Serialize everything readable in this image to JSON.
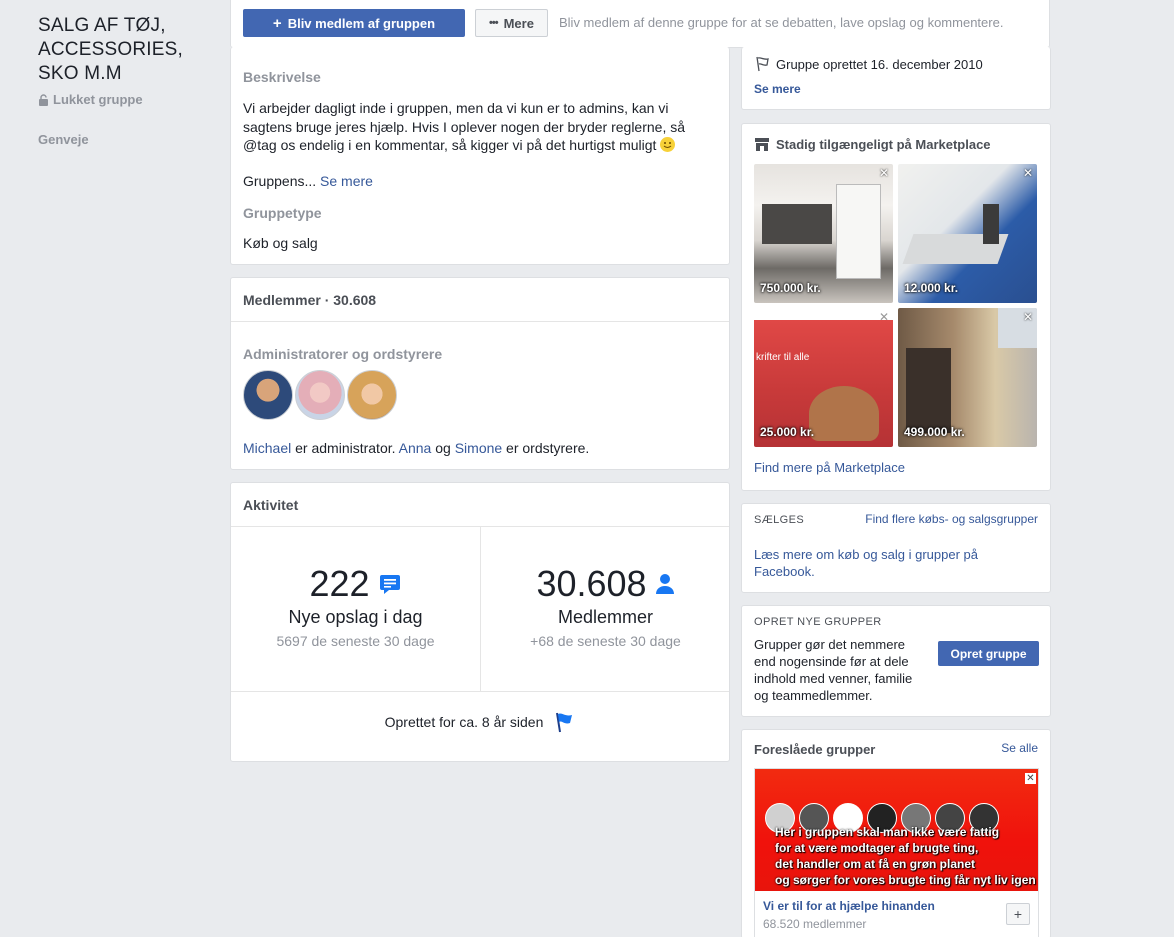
{
  "group": {
    "title": "SALG AF TØJ, ACCESSORIES, SKO M.M",
    "privacy": "Lukket gruppe",
    "shortcuts_label": "Genveje"
  },
  "join_bar": {
    "join_label": "Bliv medlem af gruppen",
    "more_label": "Mere",
    "hint": "Bliv medlem af denne gruppe for at se debatten, lave opslag og kommentere."
  },
  "about": {
    "description_heading": "Beskrivelse",
    "description_text": "Vi arbejder dagligt inde i gruppen, men da vi kun er to admins, kan vi sagtens bruge jeres hjælp. Hvis I oplever nogen der bryder reglerne, så @tag os endelig i en kommentar, så kigger vi på det hurtigst muligt",
    "description_truncated": "Gruppens...",
    "see_more": "Se mere",
    "type_heading": "Gruppetype",
    "type_value": "Køb og salg"
  },
  "members": {
    "heading": "Medlemmer · 30.608",
    "admins_heading": "Administratorer og ordstyrere",
    "admin_name": "Michael",
    "admin_suffix": " er administrator. ",
    "mod1": "Anna",
    "and": " og ",
    "mod2": "Simone",
    "mods_suffix": " er ordstyrere."
  },
  "activity": {
    "heading": "Aktivitet",
    "posts_count": "222",
    "posts_label": "Nye opslag i dag",
    "posts_sub": "5697 de seneste 30 dage",
    "members_count": "30.608",
    "members_label": "Medlemmer",
    "members_sub": "+68 de seneste 30 dage",
    "created_ago": "Oprettet for ca. 8 år siden"
  },
  "info": {
    "created": "Gruppe oprettet 16. december 2010",
    "see_more": "Se mere"
  },
  "marketplace": {
    "heading": "Stadig tilgængeligt på Marketplace",
    "items": [
      {
        "price": "750.000 kr."
      },
      {
        "price": "12.000 kr."
      },
      {
        "price": "25.000 kr."
      },
      {
        "price": "499.000 kr."
      }
    ],
    "item3_caption": "krifter til alle",
    "link": "Find mere på Marketplace"
  },
  "selling": {
    "heading": "SÆLGES",
    "find_more": "Find flere købs- og salgsgrupper",
    "read_more": "Læs mere om køb og salg i grupper på Facebook."
  },
  "create_group": {
    "heading": "OPRET NYE GRUPPER",
    "text": "Grupper gør det nemmere end nogensinde før at dele indhold med venner, familie og teammedlemmer.",
    "button": "Opret gruppe"
  },
  "suggested": {
    "heading": "Foreslåede grupper",
    "see_all": "Se alle",
    "image_lines": [
      "Her i gruppen skal man ikke være fattig",
      "for at være modtager af brugte ting,",
      "det handler om at få en grøn planet",
      "og sørger for vores brugte ting får nyt liv igen"
    ],
    "name": "Vi er til for at hjælpe hinanden",
    "members": "68.520 medlemmer"
  },
  "colors": {
    "brand_blue": "#4267b2",
    "link_blue": "#365899",
    "background": "#e9ebee"
  }
}
